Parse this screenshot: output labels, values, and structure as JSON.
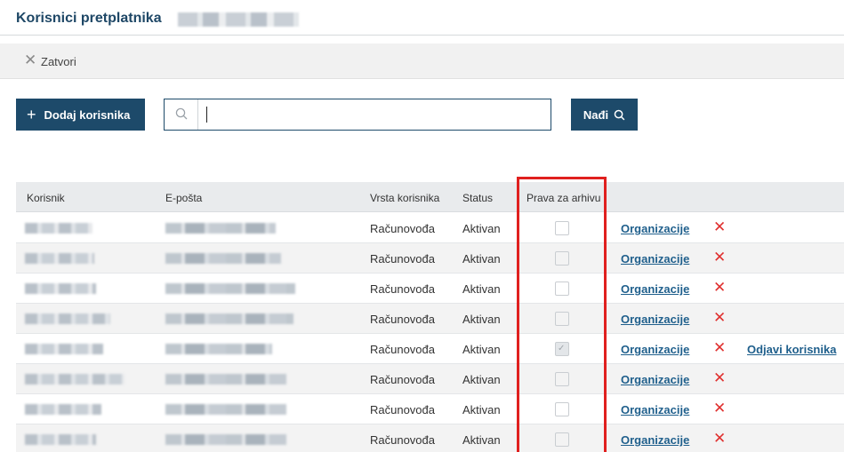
{
  "header": {
    "title": "Korisnici pretplatnika"
  },
  "closebar": {
    "close_label": "Zatvori",
    "icon": "close-icon"
  },
  "toolbar": {
    "add_label": "Dodaj korisnika",
    "find_label": "Nađi"
  },
  "search": {
    "value": "",
    "placeholder": ""
  },
  "table": {
    "columns": [
      "Korisnik",
      "E-pošta",
      "Vrsta korisnika",
      "Status",
      "Prava za arhivu"
    ],
    "rows": [
      {
        "type": "Računovođa",
        "status": "Aktivan",
        "archive": false,
        "org_link": "Organizacije",
        "logout": ""
      },
      {
        "type": "Računovođa",
        "status": "Aktivan",
        "archive": false,
        "org_link": "Organizacije",
        "logout": ""
      },
      {
        "type": "Računovođa",
        "status": "Aktivan",
        "archive": false,
        "org_link": "Organizacije",
        "logout": ""
      },
      {
        "type": "Računovođa",
        "status": "Aktivan",
        "archive": false,
        "org_link": "Organizacije",
        "logout": ""
      },
      {
        "type": "Računovođa",
        "status": "Aktivan",
        "archive": true,
        "org_link": "Organizacije",
        "logout": "Odjavi korisnika"
      },
      {
        "type": "Računovođa",
        "status": "Aktivan",
        "archive": false,
        "org_link": "Organizacije",
        "logout": ""
      },
      {
        "type": "Računovođa",
        "status": "Aktivan",
        "archive": false,
        "org_link": "Organizacije",
        "logout": ""
      },
      {
        "type": "Računovođa",
        "status": "Aktivan",
        "archive": false,
        "org_link": "Organizacije",
        "logout": ""
      }
    ]
  },
  "colors": {
    "primary": "#1d4a6a",
    "link": "#1f5f8c",
    "delete": "#e0302f",
    "highlight": "#e0201f"
  }
}
